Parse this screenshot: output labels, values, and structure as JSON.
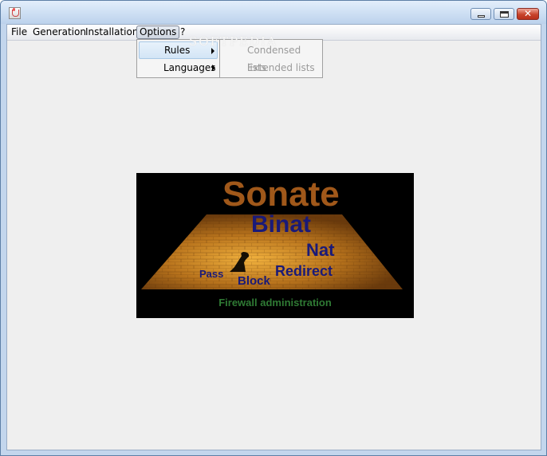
{
  "menubar": {
    "items": [
      "File",
      "Generation",
      "Installation",
      "Options",
      "?"
    ]
  },
  "options_menu": {
    "items": [
      {
        "label": "Rules"
      },
      {
        "label": "Languages"
      }
    ]
  },
  "rules_submenu": {
    "items": [
      {
        "label": "Condensed lists"
      },
      {
        "label": "Extended lists"
      }
    ]
  },
  "watermark": "SOFTPEDIA",
  "splash": {
    "title": "Sonate",
    "words": [
      "Binat",
      "Nat",
      "Redirect",
      "Block",
      "Pass"
    ],
    "subtitle": "Firewall administration",
    "colors": {
      "title": "#a0581a",
      "words": "#1a1a78",
      "subtitle": "#2f7a34"
    }
  }
}
